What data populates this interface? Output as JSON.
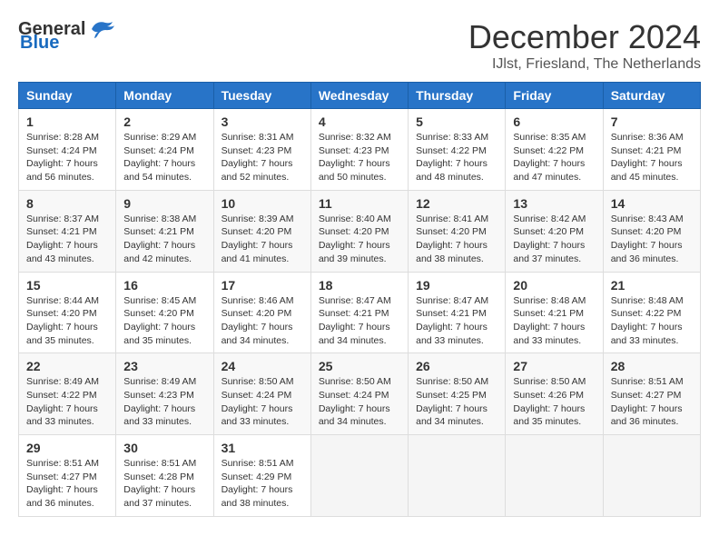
{
  "logo": {
    "general": "General",
    "blue": "Blue"
  },
  "title": "December 2024",
  "location": "IJlst, Friesland, The Netherlands",
  "days_of_week": [
    "Sunday",
    "Monday",
    "Tuesday",
    "Wednesday",
    "Thursday",
    "Friday",
    "Saturday"
  ],
  "weeks": [
    [
      {
        "day": "1",
        "sunrise": "8:28 AM",
        "sunset": "4:24 PM",
        "daylight": "7 hours and 56 minutes."
      },
      {
        "day": "2",
        "sunrise": "8:29 AM",
        "sunset": "4:24 PM",
        "daylight": "7 hours and 54 minutes."
      },
      {
        "day": "3",
        "sunrise": "8:31 AM",
        "sunset": "4:23 PM",
        "daylight": "7 hours and 52 minutes."
      },
      {
        "day": "4",
        "sunrise": "8:32 AM",
        "sunset": "4:23 PM",
        "daylight": "7 hours and 50 minutes."
      },
      {
        "day": "5",
        "sunrise": "8:33 AM",
        "sunset": "4:22 PM",
        "daylight": "7 hours and 48 minutes."
      },
      {
        "day": "6",
        "sunrise": "8:35 AM",
        "sunset": "4:22 PM",
        "daylight": "7 hours and 47 minutes."
      },
      {
        "day": "7",
        "sunrise": "8:36 AM",
        "sunset": "4:21 PM",
        "daylight": "7 hours and 45 minutes."
      }
    ],
    [
      {
        "day": "8",
        "sunrise": "8:37 AM",
        "sunset": "4:21 PM",
        "daylight": "7 hours and 43 minutes."
      },
      {
        "day": "9",
        "sunrise": "8:38 AM",
        "sunset": "4:21 PM",
        "daylight": "7 hours and 42 minutes."
      },
      {
        "day": "10",
        "sunrise": "8:39 AM",
        "sunset": "4:20 PM",
        "daylight": "7 hours and 41 minutes."
      },
      {
        "day": "11",
        "sunrise": "8:40 AM",
        "sunset": "4:20 PM",
        "daylight": "7 hours and 39 minutes."
      },
      {
        "day": "12",
        "sunrise": "8:41 AM",
        "sunset": "4:20 PM",
        "daylight": "7 hours and 38 minutes."
      },
      {
        "day": "13",
        "sunrise": "8:42 AM",
        "sunset": "4:20 PM",
        "daylight": "7 hours and 37 minutes."
      },
      {
        "day": "14",
        "sunrise": "8:43 AM",
        "sunset": "4:20 PM",
        "daylight": "7 hours and 36 minutes."
      }
    ],
    [
      {
        "day": "15",
        "sunrise": "8:44 AM",
        "sunset": "4:20 PM",
        "daylight": "7 hours and 35 minutes."
      },
      {
        "day": "16",
        "sunrise": "8:45 AM",
        "sunset": "4:20 PM",
        "daylight": "7 hours and 35 minutes."
      },
      {
        "day": "17",
        "sunrise": "8:46 AM",
        "sunset": "4:20 PM",
        "daylight": "7 hours and 34 minutes."
      },
      {
        "day": "18",
        "sunrise": "8:47 AM",
        "sunset": "4:21 PM",
        "daylight": "7 hours and 34 minutes."
      },
      {
        "day": "19",
        "sunrise": "8:47 AM",
        "sunset": "4:21 PM",
        "daylight": "7 hours and 33 minutes."
      },
      {
        "day": "20",
        "sunrise": "8:48 AM",
        "sunset": "4:21 PM",
        "daylight": "7 hours and 33 minutes."
      },
      {
        "day": "21",
        "sunrise": "8:48 AM",
        "sunset": "4:22 PM",
        "daylight": "7 hours and 33 minutes."
      }
    ],
    [
      {
        "day": "22",
        "sunrise": "8:49 AM",
        "sunset": "4:22 PM",
        "daylight": "7 hours and 33 minutes."
      },
      {
        "day": "23",
        "sunrise": "8:49 AM",
        "sunset": "4:23 PM",
        "daylight": "7 hours and 33 minutes."
      },
      {
        "day": "24",
        "sunrise": "8:50 AM",
        "sunset": "4:24 PM",
        "daylight": "7 hours and 33 minutes."
      },
      {
        "day": "25",
        "sunrise": "8:50 AM",
        "sunset": "4:24 PM",
        "daylight": "7 hours and 34 minutes."
      },
      {
        "day": "26",
        "sunrise": "8:50 AM",
        "sunset": "4:25 PM",
        "daylight": "7 hours and 34 minutes."
      },
      {
        "day": "27",
        "sunrise": "8:50 AM",
        "sunset": "4:26 PM",
        "daylight": "7 hours and 35 minutes."
      },
      {
        "day": "28",
        "sunrise": "8:51 AM",
        "sunset": "4:27 PM",
        "daylight": "7 hours and 36 minutes."
      }
    ],
    [
      {
        "day": "29",
        "sunrise": "8:51 AM",
        "sunset": "4:27 PM",
        "daylight": "7 hours and 36 minutes."
      },
      {
        "day": "30",
        "sunrise": "8:51 AM",
        "sunset": "4:28 PM",
        "daylight": "7 hours and 37 minutes."
      },
      {
        "day": "31",
        "sunrise": "8:51 AM",
        "sunset": "4:29 PM",
        "daylight": "7 hours and 38 minutes."
      },
      null,
      null,
      null,
      null
    ]
  ],
  "labels": {
    "sunrise": "Sunrise:",
    "sunset": "Sunset:",
    "daylight": "Daylight:"
  }
}
